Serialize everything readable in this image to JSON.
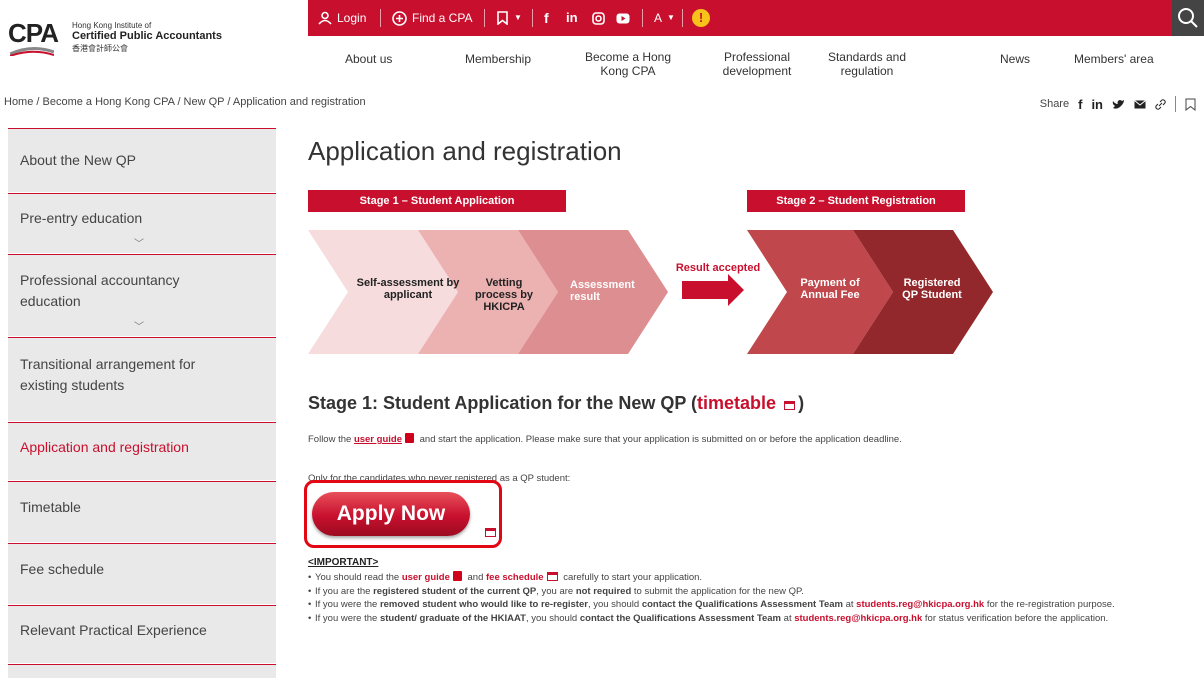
{
  "logo": {
    "short": "CPA",
    "line1": "Hong Kong Institute of",
    "line2": "Certified Public Accountants",
    "line3": "香港會計師公會"
  },
  "topbar": {
    "login": "Login",
    "find_cpa": "Find a CPA",
    "lang": "A",
    "alert": "!",
    "color": "#c8102e"
  },
  "nav": {
    "items": [
      {
        "label": "About us"
      },
      {
        "label": "Membership"
      },
      {
        "label": "Become a Hong Kong CPA"
      },
      {
        "label": "Professional development"
      },
      {
        "label": "Standards and regulation"
      },
      {
        "label": "News"
      },
      {
        "label": "Members' area"
      }
    ]
  },
  "breadcrumb": "Home / Become a Hong Kong CPA / New QP / Application and registration",
  "share": {
    "label": "Share"
  },
  "sidebar": {
    "items": [
      {
        "label": "About the New QP"
      },
      {
        "label": "Pre-entry education"
      },
      {
        "label": "Professional accountancy education"
      },
      {
        "label": "Transitional arrangement for existing students"
      },
      {
        "label": "Application and registration"
      },
      {
        "label": "Timetable"
      },
      {
        "label": "Fee schedule"
      },
      {
        "label": "Relevant Practical Experience"
      }
    ]
  },
  "page_title": "Application and registration",
  "diagram": {
    "stage1": "Stage 1 – Student Application",
    "stage2": "Stage 2 – Student Registration",
    "steps": [
      "Self-assessment by applicant",
      "Vetting process by HKICPA",
      "Assessment result",
      "Payment of Annual Fee",
      "Registered QP Student"
    ],
    "arrow_label": "Result accepted"
  },
  "section": {
    "heading_pre": "Stage 1: Student Application for the New QP (",
    "heading_link": "timetable",
    "heading_post": ")",
    "follow_pre": "Follow the ",
    "user_guide": "user guide",
    "follow_post": " and start the application.  Please make sure that your application is submitted on or before the application deadline.",
    "only_for": "Only for the candidates who never registered as a QP student:",
    "apply": "Apply Now",
    "important": "<IMPORTANT>",
    "b1_pre": "You should read the ",
    "b1_ug": "user guide",
    "b1_and": " and ",
    "b1_fee": "fee schedule",
    "b1_post": " carefully to start your application.",
    "b2_pre": "If you are the ",
    "b2_b1": "registered student of the current QP",
    "b2_mid": ", you are ",
    "b2_b2": "not required",
    "b2_post": " to submit the application for the new QP.",
    "b3_pre": "If you were the ",
    "b3_b1": "removed student who would like to re-register",
    "b3_mid": ", you should ",
    "b3_b2": "contact the Qualifications Assessment Team",
    "b3_at": " at ",
    "email": "students.reg@hkicpa.org.hk",
    "b3_post": " for the re-registration purpose.",
    "b4_pre": "If you were the ",
    "b4_b1": "student/ graduate of the HKIAAT",
    "b4_mid": ", you should ",
    "b4_b2": "contact the Qualifications Assessment Team",
    "b4_at": " at ",
    "b4_post": " for status verification before the application."
  }
}
